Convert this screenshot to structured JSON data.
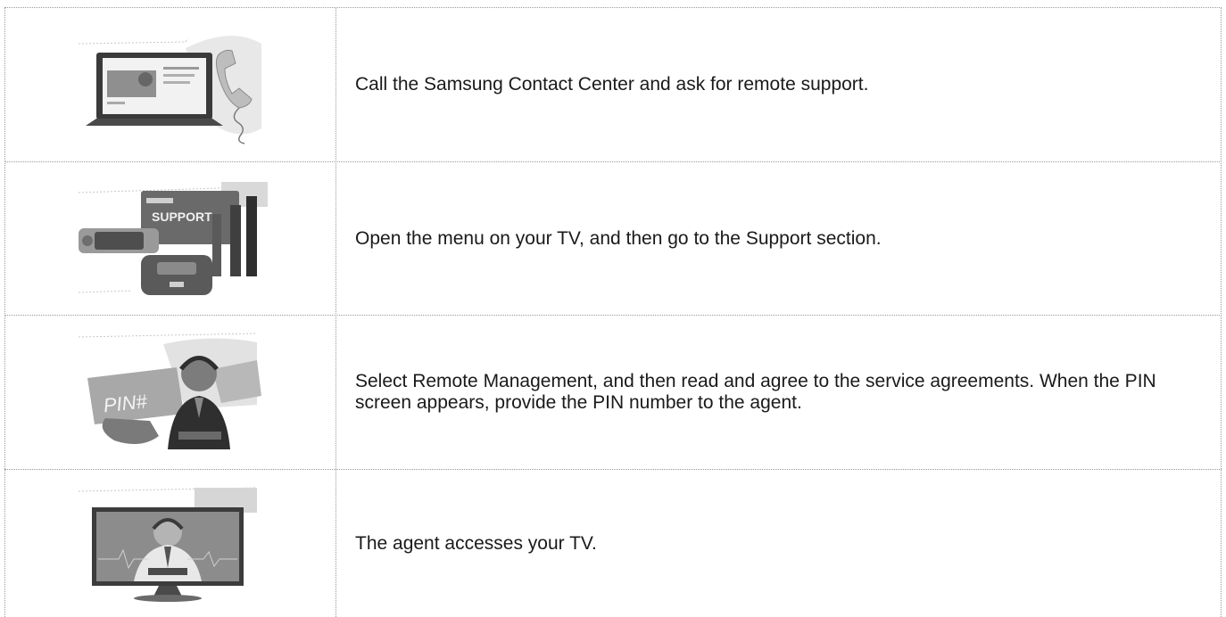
{
  "steps": [
    {
      "illustration": "laptop-and-phone-illustration",
      "text": "Call the Samsung Contact Center and ask for remote support."
    },
    {
      "illustration": "tv-menu-support-illustration",
      "illustration_label": "SUPPORT",
      "text": "Open the menu on your TV, and then go to the Support section."
    },
    {
      "illustration": "pin-agent-illustration",
      "illustration_label": "PIN#",
      "text": "Select Remote Management, and then read and agree to the service agreements. When the PIN screen appears, provide the PIN number to the agent."
    },
    {
      "illustration": "agent-on-tv-illustration",
      "text": "The agent accesses your TV."
    }
  ]
}
